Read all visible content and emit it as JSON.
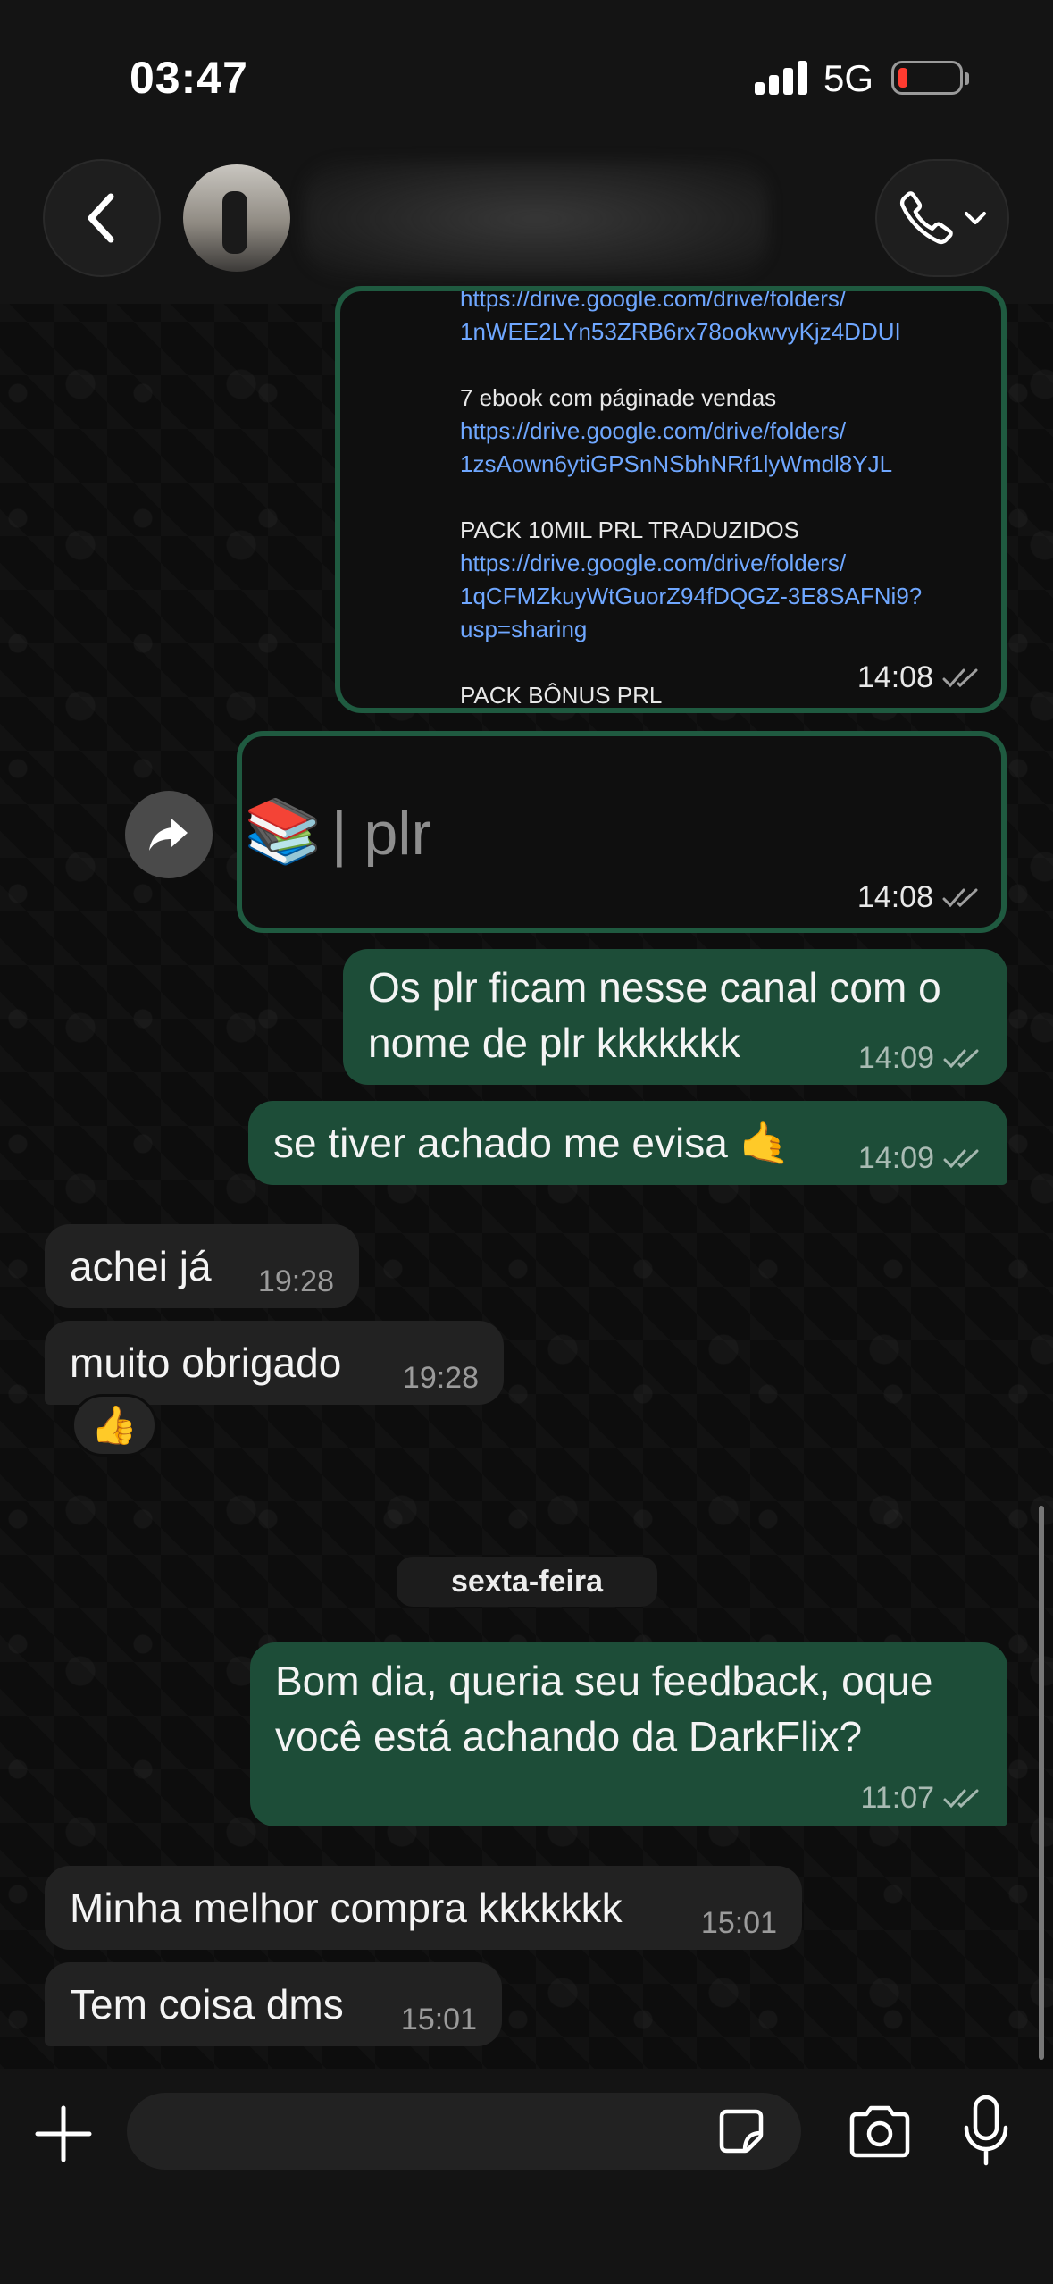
{
  "status": {
    "time": "03:47",
    "network": "5G"
  },
  "document_message": {
    "lines": [
      {
        "text": "https://drive.google.com/drive/folders/",
        "type": "link"
      },
      {
        "text": "1nWEE2LYn53ZRB6rx78ookwvyKjz4DDUI",
        "type": "link"
      },
      {
        "text": "",
        "type": "text"
      },
      {
        "text": "7 ebook com páginade vendas",
        "type": "text"
      },
      {
        "text": "https://drive.google.com/drive/folders/",
        "type": "link"
      },
      {
        "text": "1zsAown6ytiGPSnNSbhNRf1lyWmdl8YJL",
        "type": "link"
      },
      {
        "text": "",
        "type": "text"
      },
      {
        "text": "PACK 10MIL PRL TRADUZIDOS",
        "type": "text"
      },
      {
        "text": "https://drive.google.com/drive/folders/",
        "type": "link"
      },
      {
        "text": "1qCFMZkuyWtGuorZ94fDQGZ-3E8SAFNi9?",
        "type": "link"
      },
      {
        "text": "usp=sharing",
        "type": "link"
      },
      {
        "text": "",
        "type": "text"
      },
      {
        "text": "PACK BÔNUS PRL",
        "type": "text"
      }
    ],
    "time": "14:08"
  },
  "forwarded_message": {
    "emoji": "📚",
    "text": "| plr",
    "time": "14:08"
  },
  "messages": [
    {
      "id": "m1",
      "direction": "out",
      "text": "Os plr ficam nesse canal com o nome de plr kkkkkkk",
      "time": "14:09"
    },
    {
      "id": "m2",
      "direction": "out",
      "text": "se tiver achado me evisa 🤙",
      "time": "14:09"
    },
    {
      "id": "m3",
      "direction": "in",
      "text": "achei já",
      "time": "19:28"
    },
    {
      "id": "m4",
      "direction": "in",
      "text": "muito obrigado",
      "time": "19:28",
      "reaction": "👍"
    },
    {
      "id": "m5",
      "direction": "out",
      "text": "Bom dia, queria seu feedback, oque você está achando da DarkFlix?",
      "time": "11:07"
    },
    {
      "id": "m6",
      "direction": "in",
      "text": "Minha melhor compra kkkkkkk",
      "time": "15:01"
    },
    {
      "id": "m7",
      "direction": "in",
      "text": "Tem coisa dms",
      "time": "15:01"
    }
  ],
  "day_separator": "sexta-feira",
  "input": {
    "placeholder": ""
  },
  "icons": {
    "back": "chevron-left-icon",
    "call": "phone-icon",
    "forward": "forward-arrow-icon",
    "plus": "plus-icon",
    "sticker": "sticker-icon",
    "camera": "camera-icon",
    "mic": "microphone-icon",
    "read": "double-check-icon"
  },
  "colors": {
    "outgoing": "#1d4d38",
    "incoming": "#222222",
    "link": "#6fa7ff",
    "battery_low": "#ff3b30"
  }
}
